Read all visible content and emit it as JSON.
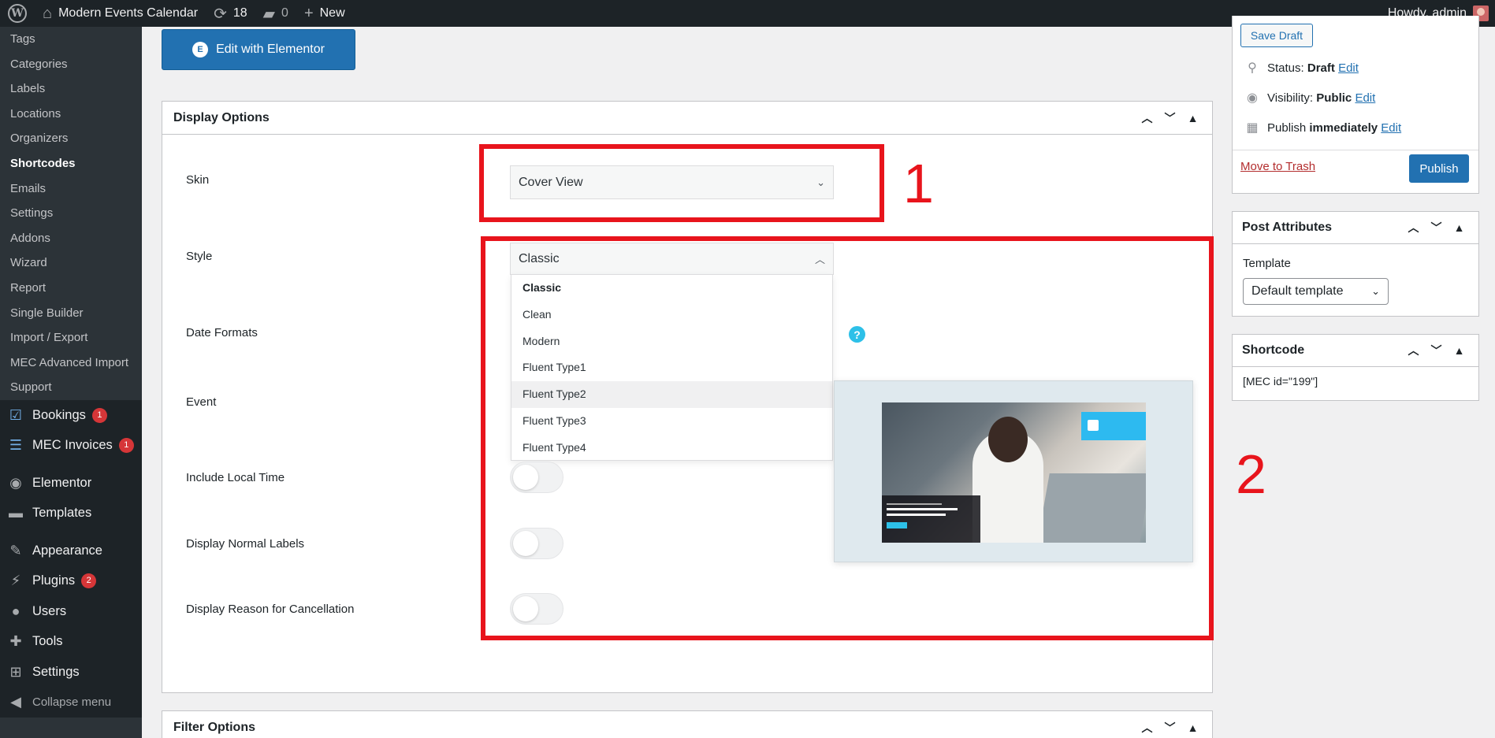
{
  "adminbar": {
    "site_name": "Modern Events Calendar",
    "updates_count": "18",
    "comments_count": "0",
    "new_label": "New",
    "howdy": "Howdy, admin"
  },
  "sidebar": {
    "submenu": [
      {
        "label": "Tags",
        "current": false
      },
      {
        "label": "Categories",
        "current": false
      },
      {
        "label": "Labels",
        "current": false
      },
      {
        "label": "Locations",
        "current": false
      },
      {
        "label": "Organizers",
        "current": false
      },
      {
        "label": "Shortcodes",
        "current": true
      },
      {
        "label": "Emails",
        "current": false
      },
      {
        "label": "Settings",
        "current": false
      },
      {
        "label": "Addons",
        "current": false
      },
      {
        "label": "Wizard",
        "current": false
      },
      {
        "label": "Report",
        "current": false
      },
      {
        "label": "Single Builder",
        "current": false
      },
      {
        "label": "Import / Export",
        "current": false
      },
      {
        "label": "MEC Advanced Import",
        "current": false
      },
      {
        "label": "Support",
        "current": false
      }
    ],
    "menu": [
      {
        "label": "Bookings",
        "icon": "calendar-check-icon",
        "badge": "1"
      },
      {
        "label": "MEC Invoices",
        "icon": "invoice-icon",
        "badge": "1"
      },
      {
        "label": "Elementor",
        "icon": "elementor-icon",
        "badge": ""
      },
      {
        "label": "Templates",
        "icon": "folder-icon",
        "badge": ""
      },
      {
        "label": "Appearance",
        "icon": "paintbrush-icon",
        "badge": ""
      },
      {
        "label": "Plugins",
        "icon": "plugin-icon",
        "badge": "2"
      },
      {
        "label": "Users",
        "icon": "user-icon",
        "badge": ""
      },
      {
        "label": "Tools",
        "icon": "wrench-icon",
        "badge": ""
      },
      {
        "label": "Settings",
        "icon": "settings-icon",
        "badge": ""
      }
    ],
    "collapse_label": "Collapse menu"
  },
  "main": {
    "edit_elementor_label": "Edit with Elementor",
    "display_options": {
      "title": "Display Options",
      "skin_label": "Skin",
      "skin_value": "Cover View",
      "style_label": "Style",
      "style_value": "Classic",
      "style_options": [
        {
          "label": "Classic",
          "selected": true,
          "hover": false
        },
        {
          "label": "Clean",
          "selected": false,
          "hover": false
        },
        {
          "label": "Modern",
          "selected": false,
          "hover": false
        },
        {
          "label": "Fluent Type1",
          "selected": false,
          "hover": false
        },
        {
          "label": "Fluent Type2",
          "selected": false,
          "hover": true
        },
        {
          "label": "Fluent Type3",
          "selected": false,
          "hover": false
        },
        {
          "label": "Fluent Type4",
          "selected": false,
          "hover": false
        }
      ],
      "date_formats_label": "Date Formats",
      "event_label": "Event",
      "include_local_time_label": "Include Local Time",
      "display_normal_labels_label": "Display Normal Labels",
      "display_reason_label": "Display Reason for Cancellation",
      "help_glyph": "?"
    },
    "filter_options": {
      "title": "Filter Options"
    }
  },
  "annotations": {
    "box1_number": "1",
    "box2_number": "2",
    "color": "#e8141c"
  },
  "publish_box": {
    "save_draft_label": "Save Draft",
    "status_label": "Status:",
    "status_value": "Draft",
    "visibility_label": "Visibility:",
    "visibility_value": "Public",
    "publish_label": "Publish",
    "publish_value": "immediately",
    "edit_label": "Edit",
    "trash_label": "Move to Trash",
    "publish_button": "Publish"
  },
  "post_attributes": {
    "title": "Post Attributes",
    "template_label": "Template",
    "template_value": "Default template"
  },
  "shortcode_box": {
    "title": "Shortcode",
    "value": "[MEC id=\"199\"]"
  },
  "colors": {
    "admin_bar": "#1d2327",
    "sidebar": "#2c3338",
    "primary": "#2271b1",
    "badge": "#d63638",
    "help": "#2dc0e8"
  }
}
